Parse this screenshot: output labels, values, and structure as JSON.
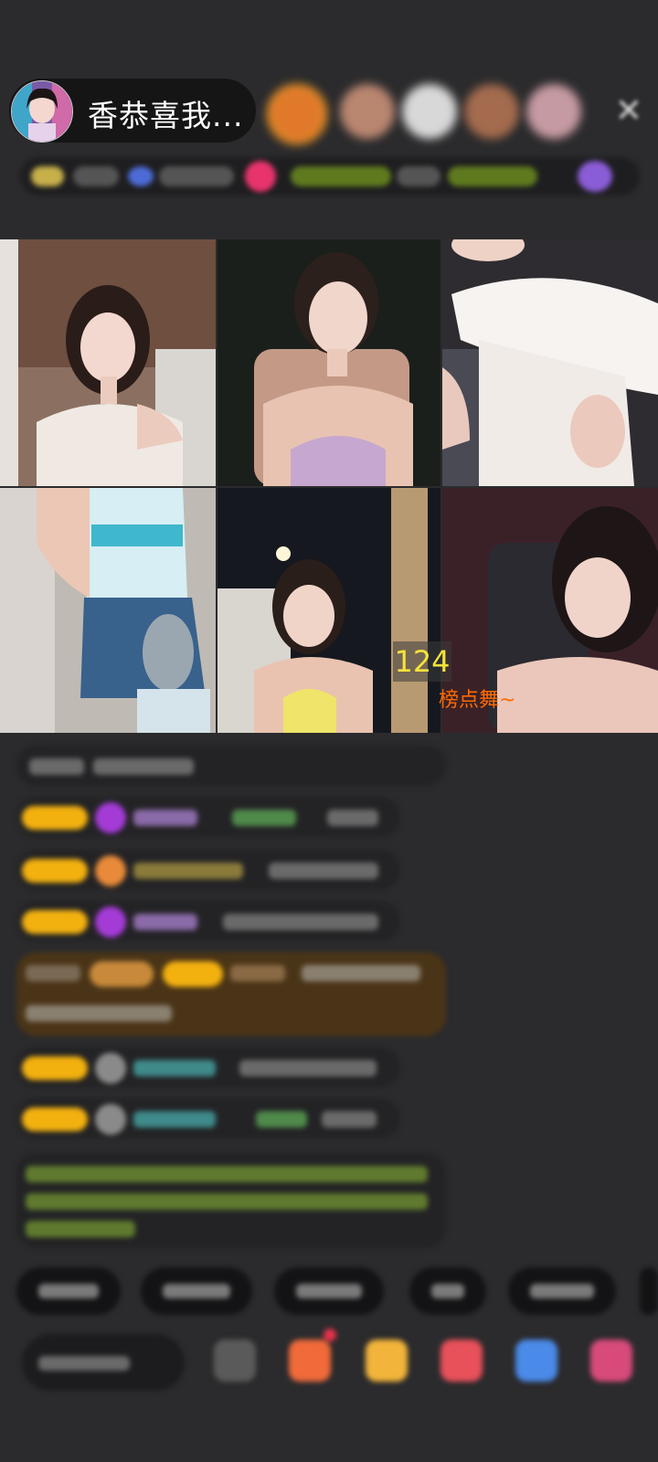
{
  "header": {
    "host_name": "香恭喜我...",
    "viewer_avatars": [
      "viewer-1",
      "viewer-2",
      "viewer-3",
      "viewer-4",
      "viewer-5"
    ],
    "close_icon": "close-icon"
  },
  "video": {
    "tile_number": "124",
    "tile_caption": "榜点舞~"
  },
  "bottom": {
    "icons": [
      "emoji-icon",
      "gift-box-icon",
      "treasure-icon",
      "heart-gift-icon",
      "game-icon",
      "more-gift-icon"
    ]
  },
  "colors": {
    "background": "#2b2b2d",
    "badge": "#f3b10f",
    "number": "#f4e33a",
    "caption": "#ff6a00"
  }
}
